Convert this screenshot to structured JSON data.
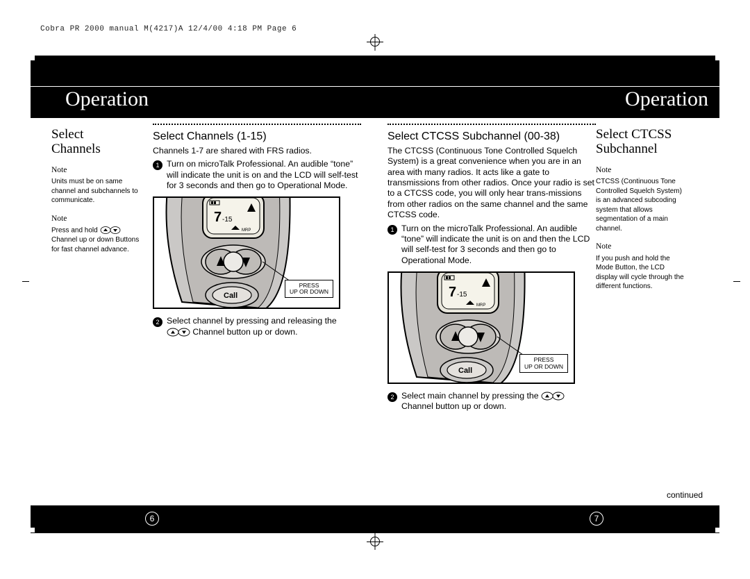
{
  "print_header": "Cobra PR 2000 manual M(4217)A  12/4/00  4:18 PM  Page 6",
  "titles": {
    "left": "Operation",
    "right": "Operation"
  },
  "page_numbers": {
    "left": "6",
    "right": "7"
  },
  "continued_label": "continued",
  "sidebar_left": {
    "heading_line1": "Select",
    "heading_line2": "Channels",
    "note1_label": "Note",
    "note1_text": "Units must be on same channel and subchannels to communicate.",
    "note2_label": "Note",
    "note2_pre": "Press and hold ",
    "note2_post": " Channel up or down Buttons for fast channel advance."
  },
  "sidebar_right": {
    "heading_line1": "Select CTCSS",
    "heading_line2": "Subchannel",
    "note1_label": "Note",
    "note1_text": "CTCSS (Continuous Tone Controlled Squelch System) is an advanced subcoding system that allows segmentation of a main channel.",
    "note2_label": "Note",
    "note2_text": "If you push and hold the Mode Button, the LCD display will cycle through the different functions."
  },
  "col1": {
    "heading": "Select Channels (1-15)",
    "intro": "Channels 1-7 are shared with FRS radios.",
    "step1_num": "1",
    "step1_text": "Turn on microTalk Professional. An audible “tone” will indicate the unit is on and the LCD will self-test for 3 seconds and then go to Operational Mode.",
    "callout_line1": "PRESS",
    "callout_line2": "UP OR DOWN",
    "step2_num": "2",
    "step2_pre": "Select channel by pressing and releasing the ",
    "step2_post": " Channel button up or down."
  },
  "col2": {
    "heading": "Select CTCSS Subchannel (00-38)",
    "intro": "The CTCSS (Continuous Tone Controlled Squelch System) is a great convenience when you are in an area with many radios. It acts like a gate to transmissions from other radios. Once your radio is set to a CTCSS code, you will only hear trans-missions from other radios on the same channel and the same CTCSS code.",
    "step1_num": "1",
    "step1_text": "Turn on the microTalk Professional. An audible “tone” will indicate the unit is on and then the LCD will self-test for 3 seconds and then go to Operational Mode.",
    "callout_line1": "PRESS",
    "callout_line2": "UP OR DOWN",
    "step2_num": "2",
    "step2_pre": "Select main channel by pressing the ",
    "step2_post": " Channel button up or down."
  },
  "device": {
    "lcd_text1": "7-15",
    "lcd_icon_text": "MRP",
    "call_label": "Call"
  }
}
